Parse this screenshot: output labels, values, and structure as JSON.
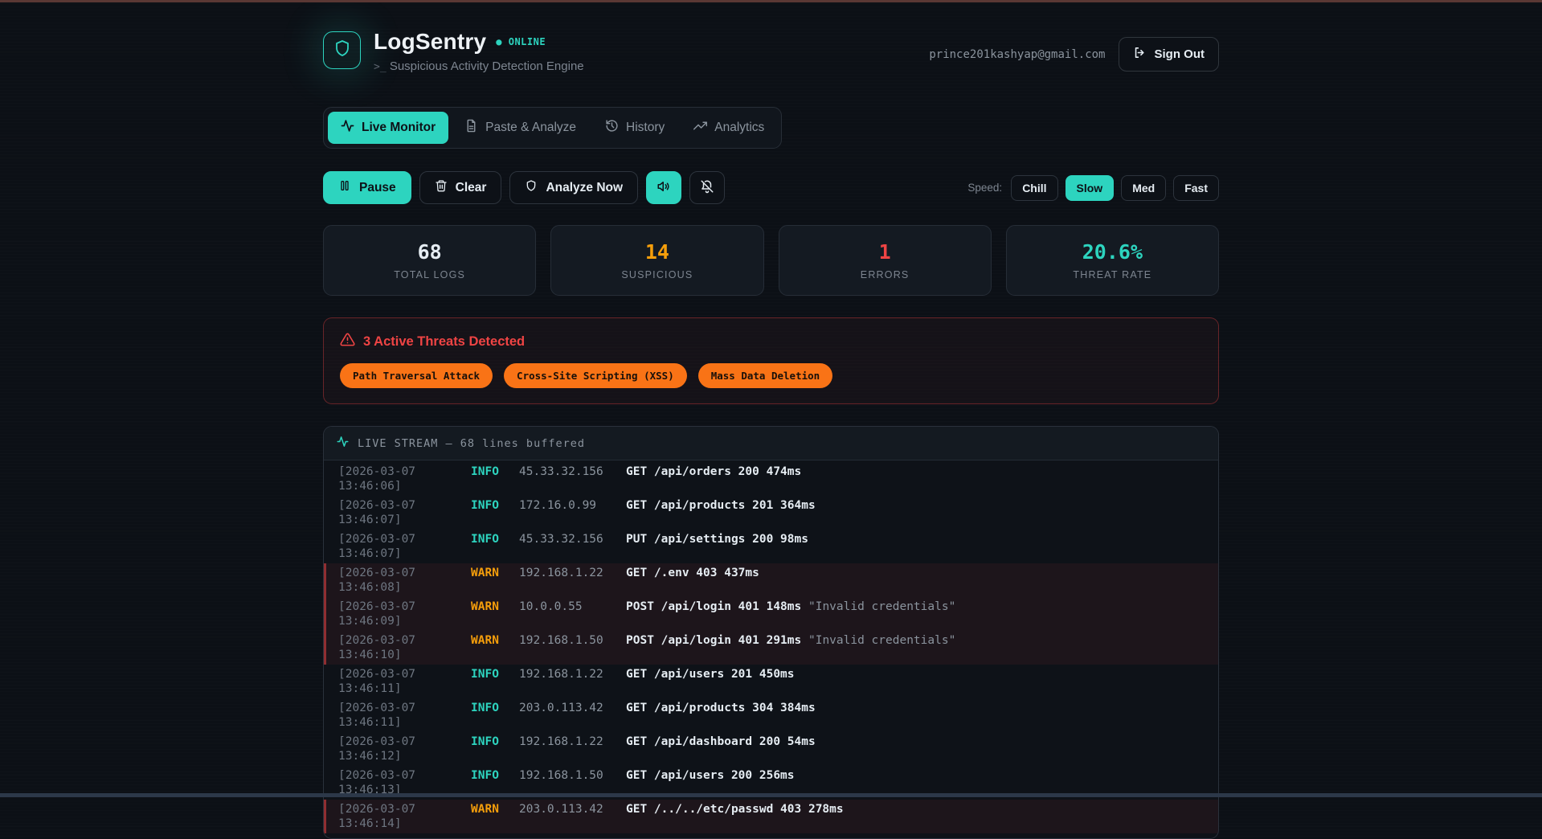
{
  "header": {
    "app_name": "LogSentry",
    "status": "ONLINE",
    "subtitle_prompt": ">_",
    "subtitle": "Suspicious Activity Detection Engine",
    "user_email": "prince201kashyap@gmail.com",
    "sign_out_label": "Sign Out"
  },
  "tabs": [
    {
      "label": "Live Monitor",
      "active": true
    },
    {
      "label": "Paste & Analyze",
      "active": false
    },
    {
      "label": "History",
      "active": false
    },
    {
      "label": "Analytics",
      "active": false
    }
  ],
  "controls": {
    "pause_label": "Pause",
    "clear_label": "Clear",
    "analyze_label": "Analyze Now",
    "speed_label": "Speed:",
    "speeds": [
      {
        "label": "Chill",
        "active": false
      },
      {
        "label": "Slow",
        "active": true
      },
      {
        "label": "Med",
        "active": false
      },
      {
        "label": "Fast",
        "active": false
      }
    ]
  },
  "stats": [
    {
      "value": "68",
      "label": "TOTAL LOGS",
      "color": "#e6edf3"
    },
    {
      "value": "14",
      "label": "SUSPICIOUS",
      "color": "#f59e0b"
    },
    {
      "value": "1",
      "label": "ERRORS",
      "color": "#ef4444"
    },
    {
      "value": "20.6%",
      "label": "THREAT RATE",
      "color": "#2dd4bf"
    }
  ],
  "alert": {
    "title": "3 Active Threats Detected",
    "badges": [
      "Path Traversal Attack",
      "Cross-Site Scripting (XSS)",
      "Mass Data Deletion"
    ]
  },
  "stream": {
    "header": "LIVE STREAM — 68 lines buffered",
    "rows": [
      {
        "timestamp": "[2026-03-07 13:46:06]",
        "level": "INFO",
        "ip": "45.33.32.156",
        "message": "GET /api/orders 200 474ms",
        "note": "",
        "warn": false
      },
      {
        "timestamp": "[2026-03-07 13:46:07]",
        "level": "INFO",
        "ip": "172.16.0.99",
        "message": "GET /api/products 201 364ms",
        "note": "",
        "warn": false
      },
      {
        "timestamp": "[2026-03-07 13:46:07]",
        "level": "INFO",
        "ip": "45.33.32.156",
        "message": "PUT /api/settings 200 98ms",
        "note": "",
        "warn": false
      },
      {
        "timestamp": "[2026-03-07 13:46:08]",
        "level": "WARN",
        "ip": "192.168.1.22",
        "message": "GET /.env 403 437ms",
        "note": "",
        "warn": true
      },
      {
        "timestamp": "[2026-03-07 13:46:09]",
        "level": "WARN",
        "ip": "10.0.0.55",
        "message": "POST /api/login 401 148ms",
        "note": "\"Invalid credentials\"",
        "warn": true
      },
      {
        "timestamp": "[2026-03-07 13:46:10]",
        "level": "WARN",
        "ip": "192.168.1.50",
        "message": "POST /api/login 401 291ms",
        "note": "\"Invalid credentials\"",
        "warn": true
      },
      {
        "timestamp": "[2026-03-07 13:46:11]",
        "level": "INFO",
        "ip": "192.168.1.22",
        "message": "GET /api/users 201 450ms",
        "note": "",
        "warn": false
      },
      {
        "timestamp": "[2026-03-07 13:46:11]",
        "level": "INFO",
        "ip": "203.0.113.42",
        "message": "GET /api/products 304 384ms",
        "note": "",
        "warn": false
      },
      {
        "timestamp": "[2026-03-07 13:46:12]",
        "level": "INFO",
        "ip": "192.168.1.22",
        "message": "GET /api/dashboard 200 54ms",
        "note": "",
        "warn": false
      },
      {
        "timestamp": "[2026-03-07 13:46:13]",
        "level": "INFO",
        "ip": "192.168.1.50",
        "message": "GET /api/users 200 256ms",
        "note": "",
        "warn": false
      },
      {
        "timestamp": "[2026-03-07 13:46:14]",
        "level": "WARN",
        "ip": "203.0.113.42",
        "message": "GET /../../etc/passwd 403 278ms",
        "note": "",
        "warn": true
      }
    ]
  },
  "colors": {
    "accent_teal": "#2dd4bf",
    "warn_amber": "#f59e0b",
    "error_red": "#ef4444",
    "badge_orange": "#f97316"
  }
}
